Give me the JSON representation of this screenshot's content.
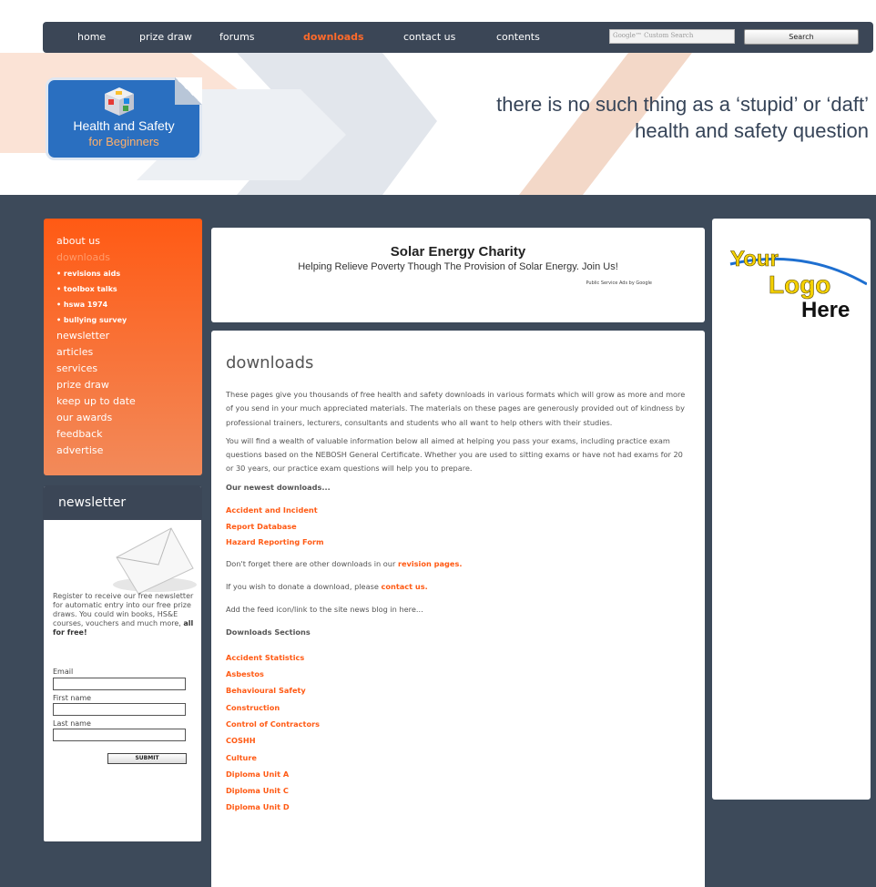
{
  "nav": {
    "items": [
      "home",
      "prize draw",
      "forums",
      "downloads",
      "contact us",
      "contents"
    ],
    "search_placeholder": "Google™ Custom Search",
    "search_button": "Search"
  },
  "header": {
    "logo_line1": "Health and Safety",
    "logo_line2": "for Beginners",
    "tagline1": "there is no such thing as a ‘stupid’ or ‘daft’",
    "tagline2": "health and safety question"
  },
  "leftnav": {
    "items": [
      {
        "label": "about us",
        "kind": "item"
      },
      {
        "label": "downloads",
        "kind": "current"
      },
      {
        "label": "• revisions aids",
        "kind": "sub"
      },
      {
        "label": "• toolbox talks",
        "kind": "sub"
      },
      {
        "label": "• hswa 1974",
        "kind": "sub"
      },
      {
        "label": "• bullying survey",
        "kind": "sub"
      },
      {
        "label": "newsletter",
        "kind": "item"
      },
      {
        "label": "articles",
        "kind": "item"
      },
      {
        "label": "services",
        "kind": "item"
      },
      {
        "label": "prize draw",
        "kind": "item"
      },
      {
        "label": "keep up to date",
        "kind": "item"
      },
      {
        "label": "our awards",
        "kind": "item"
      },
      {
        "label": "feedback",
        "kind": "item"
      },
      {
        "label": "advertise",
        "kind": "item"
      }
    ]
  },
  "newsletter": {
    "heading": "newsletter",
    "text": "Register to receive our free newsletter for automatic entry into our free prize draws. You could win books, HS&E courses, vouchers and much more,",
    "text_bold": "all for free!",
    "email_label": "Email",
    "first_name_label": "First name",
    "last_name_label": "Last name",
    "submit": "SUBMIT"
  },
  "ad": {
    "title": "Solar Energy Charity",
    "subtitle": "Helping Relieve Poverty Though The Provision of Solar Energy. Join Us!",
    "footer": "Public Service Ads by Google"
  },
  "main": {
    "title": "downloads",
    "para1": "These pages give you thousands of free health and safety downloads in various formats which will grow as more and more of you send in your much appreciated materials. The materials on these pages are generously provided out of kindness by professional trainers, lecturers, consultants and students who all want to help others with their studies.",
    "para2": "You will find a wealth of valuable information below all aimed at helping you pass your exams, including practice exam questions based on the NEBOSH General Certificate. Whether you are used to sitting exams or have not had exams for 20 or 30 years, our practice exam questions will help you to prepare.",
    "newest_heading": "Our newest downloads...",
    "newest": [
      "Accident and Incident",
      "Report Database",
      "Hazard Reporting Form"
    ],
    "revision_pre": "Don't forget there are other downloads in our",
    "revision_link": "revision pages.",
    "donate_pre": "If you wish to donate a download, please",
    "donate_link": "contact us.",
    "feed_text": "Add the feed icon/link to the site news blog in here...",
    "sections_heading": "Downloads Sections",
    "sections": [
      "Accident Statistics",
      "Asbestos",
      "Behavioural Safety",
      "Construction",
      "Control of Contractors",
      "COSHH",
      "Culture",
      "Diploma Unit A",
      "Diploma Unit C",
      "Diploma Unit D"
    ]
  },
  "right": {
    "line1": "Your",
    "line2": "Logo",
    "line3": "Here"
  },
  "colors": {
    "accent": "#ff5a14",
    "dark": "#3b4656",
    "background": "#3d4a5a"
  }
}
